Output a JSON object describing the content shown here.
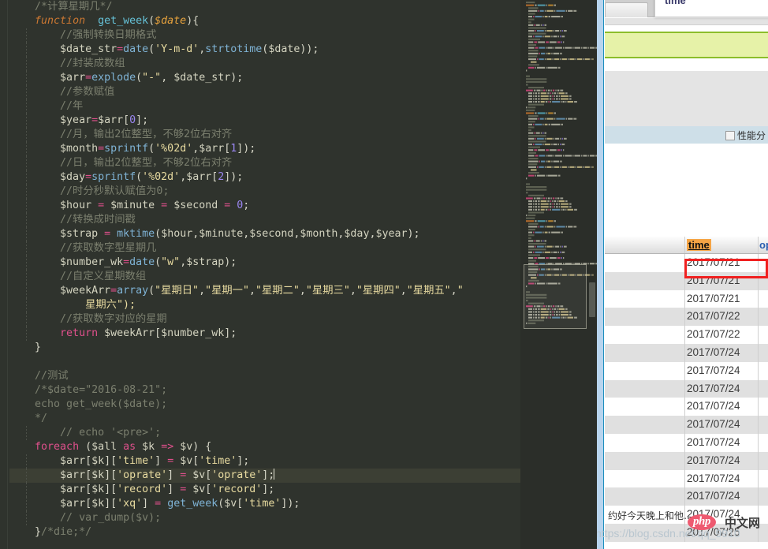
{
  "editor": {
    "language": "php",
    "lines": [
      {
        "indent": 1,
        "tokens": [
          {
            "t": "/*计算星期几*/",
            "c": "c-com"
          }
        ]
      },
      {
        "indent": 1,
        "tokens": [
          {
            "t": "function",
            "c": "c-kw c-italic"
          },
          {
            "t": "  ",
            "c": "c-pun"
          },
          {
            "t": "get_week",
            "c": "c-fn2"
          },
          {
            "t": "(",
            "c": "c-pun"
          },
          {
            "t": "$date",
            "c": "c-varo c-italic"
          },
          {
            "t": "){",
            "c": "c-pun"
          }
        ]
      },
      {
        "indent": 2,
        "tokens": [
          {
            "t": "//强制转换日期格式",
            "c": "c-com"
          }
        ]
      },
      {
        "indent": 2,
        "tokens": [
          {
            "t": "$date_str",
            "c": "c-var"
          },
          {
            "t": "=",
            "c": "c-op"
          },
          {
            "t": "date",
            "c": "c-fn"
          },
          {
            "t": "(",
            "c": "c-pun"
          },
          {
            "t": "'Y-m-d'",
            "c": "c-str"
          },
          {
            "t": ",",
            "c": "c-pun"
          },
          {
            "t": "strtotime",
            "c": "c-fn"
          },
          {
            "t": "(",
            "c": "c-pun"
          },
          {
            "t": "$date",
            "c": "c-var"
          },
          {
            "t": "));",
            "c": "c-pun"
          }
        ]
      },
      {
        "indent": 2,
        "tokens": [
          {
            "t": "//封装成数组",
            "c": "c-com"
          }
        ]
      },
      {
        "indent": 2,
        "tokens": [
          {
            "t": "$arr",
            "c": "c-var"
          },
          {
            "t": "=",
            "c": "c-op"
          },
          {
            "t": "explode",
            "c": "c-fn"
          },
          {
            "t": "(",
            "c": "c-pun"
          },
          {
            "t": "\"-\"",
            "c": "c-str"
          },
          {
            "t": ", ",
            "c": "c-pun"
          },
          {
            "t": "$date_str",
            "c": "c-var"
          },
          {
            "t": ");",
            "c": "c-pun"
          }
        ]
      },
      {
        "indent": 2,
        "tokens": [
          {
            "t": "//参数赋值",
            "c": "c-com"
          }
        ]
      },
      {
        "indent": 2,
        "tokens": [
          {
            "t": "//年",
            "c": "c-com"
          }
        ]
      },
      {
        "indent": 2,
        "tokens": [
          {
            "t": "$year",
            "c": "c-var"
          },
          {
            "t": "=",
            "c": "c-op"
          },
          {
            "t": "$arr",
            "c": "c-var"
          },
          {
            "t": "[",
            "c": "c-pun"
          },
          {
            "t": "0",
            "c": "c-num"
          },
          {
            "t": "];",
            "c": "c-pun"
          }
        ]
      },
      {
        "indent": 2,
        "tokens": [
          {
            "t": "//月，输出2位整型，不够2位右对齐",
            "c": "c-com"
          }
        ]
      },
      {
        "indent": 2,
        "tokens": [
          {
            "t": "$month",
            "c": "c-var"
          },
          {
            "t": "=",
            "c": "c-op"
          },
          {
            "t": "sprintf",
            "c": "c-fn"
          },
          {
            "t": "(",
            "c": "c-pun"
          },
          {
            "t": "'%02d'",
            "c": "c-str"
          },
          {
            "t": ",",
            "c": "c-pun"
          },
          {
            "t": "$arr",
            "c": "c-var"
          },
          {
            "t": "[",
            "c": "c-pun"
          },
          {
            "t": "1",
            "c": "c-num"
          },
          {
            "t": "]);",
            "c": "c-pun"
          }
        ]
      },
      {
        "indent": 2,
        "tokens": [
          {
            "t": "//日，输出2位整型，不够2位右对齐",
            "c": "c-com"
          }
        ]
      },
      {
        "indent": 2,
        "tokens": [
          {
            "t": "$day",
            "c": "c-var"
          },
          {
            "t": "=",
            "c": "c-op"
          },
          {
            "t": "sprintf",
            "c": "c-fn"
          },
          {
            "t": "(",
            "c": "c-pun"
          },
          {
            "t": "'%02d'",
            "c": "c-str"
          },
          {
            "t": ",",
            "c": "c-pun"
          },
          {
            "t": "$arr",
            "c": "c-var"
          },
          {
            "t": "[",
            "c": "c-pun"
          },
          {
            "t": "2",
            "c": "c-num"
          },
          {
            "t": "]);",
            "c": "c-pun"
          }
        ]
      },
      {
        "indent": 2,
        "tokens": [
          {
            "t": "//时分秒默认赋值为0;",
            "c": "c-com"
          }
        ]
      },
      {
        "indent": 2,
        "tokens": [
          {
            "t": "$hour",
            "c": "c-var"
          },
          {
            "t": " = ",
            "c": "c-op"
          },
          {
            "t": "$minute",
            "c": "c-var"
          },
          {
            "t": " = ",
            "c": "c-op"
          },
          {
            "t": "$second",
            "c": "c-var"
          },
          {
            "t": " = ",
            "c": "c-op"
          },
          {
            "t": "0",
            "c": "c-num"
          },
          {
            "t": ";",
            "c": "c-pun"
          }
        ]
      },
      {
        "indent": 2,
        "tokens": [
          {
            "t": "//转换成时间戳",
            "c": "c-com"
          }
        ]
      },
      {
        "indent": 2,
        "tokens": [
          {
            "t": "$strap",
            "c": "c-var"
          },
          {
            "t": " = ",
            "c": "c-op"
          },
          {
            "t": "mktime",
            "c": "c-fn"
          },
          {
            "t": "(",
            "c": "c-pun"
          },
          {
            "t": "$hour",
            "c": "c-var"
          },
          {
            "t": ",",
            "c": "c-pun"
          },
          {
            "t": "$minute",
            "c": "c-var"
          },
          {
            "t": ",",
            "c": "c-pun"
          },
          {
            "t": "$second",
            "c": "c-var"
          },
          {
            "t": ",",
            "c": "c-pun"
          },
          {
            "t": "$month",
            "c": "c-var"
          },
          {
            "t": ",",
            "c": "c-pun"
          },
          {
            "t": "$day",
            "c": "c-var"
          },
          {
            "t": ",",
            "c": "c-pun"
          },
          {
            "t": "$year",
            "c": "c-var"
          },
          {
            "t": ");",
            "c": "c-pun"
          }
        ]
      },
      {
        "indent": 2,
        "tokens": [
          {
            "t": "//获取数字型星期几",
            "c": "c-com"
          }
        ]
      },
      {
        "indent": 2,
        "tokens": [
          {
            "t": "$number_wk",
            "c": "c-var"
          },
          {
            "t": "=",
            "c": "c-op"
          },
          {
            "t": "date",
            "c": "c-fn"
          },
          {
            "t": "(",
            "c": "c-pun"
          },
          {
            "t": "\"w\"",
            "c": "c-str"
          },
          {
            "t": ",",
            "c": "c-pun"
          },
          {
            "t": "$strap",
            "c": "c-var"
          },
          {
            "t": ");",
            "c": "c-pun"
          }
        ]
      },
      {
        "indent": 2,
        "tokens": [
          {
            "t": "//自定义星期数组",
            "c": "c-com"
          }
        ]
      },
      {
        "indent": 2,
        "tokens": [
          {
            "t": "$weekArr",
            "c": "c-var"
          },
          {
            "t": "=",
            "c": "c-op"
          },
          {
            "t": "array",
            "c": "c-fn"
          },
          {
            "t": "(",
            "c": "c-pun"
          },
          {
            "t": "\"星期日\"",
            "c": "c-str"
          },
          {
            "t": ",",
            "c": "c-pun"
          },
          {
            "t": "\"星期一\"",
            "c": "c-str"
          },
          {
            "t": ",",
            "c": "c-pun"
          },
          {
            "t": "\"星期二\"",
            "c": "c-str"
          },
          {
            "t": ",",
            "c": "c-pun"
          },
          {
            "t": "\"星期三\"",
            "c": "c-str"
          },
          {
            "t": ",",
            "c": "c-pun"
          },
          {
            "t": "\"星期四\"",
            "c": "c-str"
          },
          {
            "t": ",",
            "c": "c-pun"
          },
          {
            "t": "\"星期五\"",
            "c": "c-str"
          },
          {
            "t": ",",
            "c": "c-pun"
          },
          {
            "t": "\"",
            "c": "c-str"
          }
        ]
      },
      {
        "indent": 3,
        "tokens": [
          {
            "t": "星期六\");",
            "c": "c-str"
          }
        ]
      },
      {
        "indent": 2,
        "tokens": [
          {
            "t": "//获取数字对应的星期",
            "c": "c-com"
          }
        ]
      },
      {
        "indent": 2,
        "tokens": [
          {
            "t": "return",
            "c": "c-kw2"
          },
          {
            "t": " ",
            "c": "c-pun"
          },
          {
            "t": "$weekArr",
            "c": "c-var"
          },
          {
            "t": "[",
            "c": "c-pun"
          },
          {
            "t": "$number_wk",
            "c": "c-var"
          },
          {
            "t": "];",
            "c": "c-pun"
          }
        ]
      },
      {
        "indent": 1,
        "tokens": [
          {
            "t": "}",
            "c": "c-pun"
          }
        ]
      },
      {
        "indent": 0,
        "tokens": []
      },
      {
        "indent": 1,
        "tokens": [
          {
            "t": "//测试",
            "c": "c-com"
          }
        ]
      },
      {
        "indent": 1,
        "tokens": [
          {
            "t": "/*$date=\"2016-08-21\";",
            "c": "c-com"
          }
        ]
      },
      {
        "indent": 1,
        "tokens": [
          {
            "t": "echo get_week($date);",
            "c": "c-com"
          }
        ]
      },
      {
        "indent": 1,
        "tokens": [
          {
            "t": "*/",
            "c": "c-com"
          }
        ]
      },
      {
        "indent": 2,
        "tokens": [
          {
            "t": "// echo '<pre>';",
            "c": "c-com"
          }
        ]
      },
      {
        "indent": 1,
        "tokens": [
          {
            "t": "foreach",
            "c": "c-kw2"
          },
          {
            "t": " (",
            "c": "c-pun"
          },
          {
            "t": "$all",
            "c": "c-var"
          },
          {
            "t": " ",
            "c": "c-pun"
          },
          {
            "t": "as",
            "c": "c-kw2"
          },
          {
            "t": " ",
            "c": "c-pun"
          },
          {
            "t": "$k",
            "c": "c-var"
          },
          {
            "t": " ",
            "c": "c-pun"
          },
          {
            "t": "=>",
            "c": "c-op"
          },
          {
            "t": " ",
            "c": "c-pun"
          },
          {
            "t": "$v",
            "c": "c-var"
          },
          {
            "t": ") {",
            "c": "c-pun"
          }
        ]
      },
      {
        "indent": 2,
        "tokens": [
          {
            "t": "$arr",
            "c": "c-var"
          },
          {
            "t": "[",
            "c": "c-pun"
          },
          {
            "t": "$k",
            "c": "c-var"
          },
          {
            "t": "][",
            "c": "c-pun"
          },
          {
            "t": "'time'",
            "c": "c-str"
          },
          {
            "t": "] ",
            "c": "c-pun"
          },
          {
            "t": "=",
            "c": "c-op"
          },
          {
            "t": " ",
            "c": "c-pun"
          },
          {
            "t": "$v",
            "c": "c-var"
          },
          {
            "t": "[",
            "c": "c-pun"
          },
          {
            "t": "'time'",
            "c": "c-str"
          },
          {
            "t": "];",
            "c": "c-pun"
          }
        ]
      },
      {
        "indent": 2,
        "hl": true,
        "caret": true,
        "tokens": [
          {
            "t": "$arr",
            "c": "c-var"
          },
          {
            "t": "[",
            "c": "c-pun"
          },
          {
            "t": "$k",
            "c": "c-var"
          },
          {
            "t": "][",
            "c": "c-pun"
          },
          {
            "t": "'oprate'",
            "c": "c-str"
          },
          {
            "t": "] ",
            "c": "c-pun"
          },
          {
            "t": "=",
            "c": "c-op"
          },
          {
            "t": " ",
            "c": "c-pun"
          },
          {
            "t": "$v",
            "c": "c-var"
          },
          {
            "t": "[",
            "c": "c-pun"
          },
          {
            "t": "'oprate'",
            "c": "c-str"
          },
          {
            "t": "];",
            "c": "c-pun"
          }
        ]
      },
      {
        "indent": 2,
        "tokens": [
          {
            "t": "$arr",
            "c": "c-var"
          },
          {
            "t": "[",
            "c": "c-pun"
          },
          {
            "t": "$k",
            "c": "c-var"
          },
          {
            "t": "][",
            "c": "c-pun"
          },
          {
            "t": "'record'",
            "c": "c-str"
          },
          {
            "t": "] ",
            "c": "c-pun"
          },
          {
            "t": "=",
            "c": "c-op"
          },
          {
            "t": " ",
            "c": "c-pun"
          },
          {
            "t": "$v",
            "c": "c-var"
          },
          {
            "t": "[",
            "c": "c-pun"
          },
          {
            "t": "'record'",
            "c": "c-str"
          },
          {
            "t": "];",
            "c": "c-pun"
          }
        ]
      },
      {
        "indent": 2,
        "tokens": [
          {
            "t": "$arr",
            "c": "c-var"
          },
          {
            "t": "[",
            "c": "c-pun"
          },
          {
            "t": "$k",
            "c": "c-var"
          },
          {
            "t": "][",
            "c": "c-pun"
          },
          {
            "t": "'xq'",
            "c": "c-str"
          },
          {
            "t": "] ",
            "c": "c-pun"
          },
          {
            "t": "=",
            "c": "c-op"
          },
          {
            "t": " ",
            "c": "c-pun"
          },
          {
            "t": "get_week",
            "c": "c-fn"
          },
          {
            "t": "(",
            "c": "c-pun"
          },
          {
            "t": "$v",
            "c": "c-var"
          },
          {
            "t": "[",
            "c": "c-pun"
          },
          {
            "t": "'time'",
            "c": "c-str"
          },
          {
            "t": "]);",
            "c": "c-pun"
          }
        ]
      },
      {
        "indent": 2,
        "tokens": [
          {
            "t": "// var_dump($v);",
            "c": "c-com"
          }
        ]
      },
      {
        "indent": 1,
        "tokens": [
          {
            "t": "}",
            "c": "c-pun"
          },
          {
            "t": "/*die;*/",
            "c": "c-com"
          }
        ]
      }
    ]
  },
  "browser": {
    "popover_text": "time",
    "perf_label": "性能分",
    "table": {
      "headers": [
        "",
        "time",
        "op"
      ],
      "rows": [
        {
          "left": "",
          "time": "2017/07/21"
        },
        {
          "left": "",
          "time": "2017/07/21"
        },
        {
          "left": "",
          "time": "2017/07/21"
        },
        {
          "left": "",
          "time": "2017/07/22"
        },
        {
          "left": "",
          "time": "2017/07/22"
        },
        {
          "left": "",
          "time": "2017/07/24"
        },
        {
          "left": "",
          "time": "2017/07/24"
        },
        {
          "left": "",
          "time": "2017/07/24"
        },
        {
          "left": "",
          "time": "2017/07/24"
        },
        {
          "left": "",
          "time": "2017/07/24"
        },
        {
          "left": "",
          "time": "2017/07/24"
        },
        {
          "left": "",
          "time": "2017/07/24"
        },
        {
          "left": "",
          "time": "2017/07/24"
        },
        {
          "left": "",
          "time": "2017/07/24"
        },
        {
          "left": "约好今天晚上和他…",
          "time": "2017/07/24"
        },
        {
          "left": "",
          "time": "2017/07/25"
        }
      ]
    }
  },
  "watermark": {
    "php_logo": "php",
    "cn_text": "中文网",
    "csdn": "https://blog.csdn.net/qq_9910"
  },
  "colors": {
    "editor_bg": "#2f332d",
    "highlight_line": "#3c3f34",
    "notice_bg": "#e6f2a8",
    "notice_border": "#8cbe2b",
    "header_accent": "#f5a445",
    "redbox": "#f02020",
    "link_blue": "#2a5db0"
  }
}
